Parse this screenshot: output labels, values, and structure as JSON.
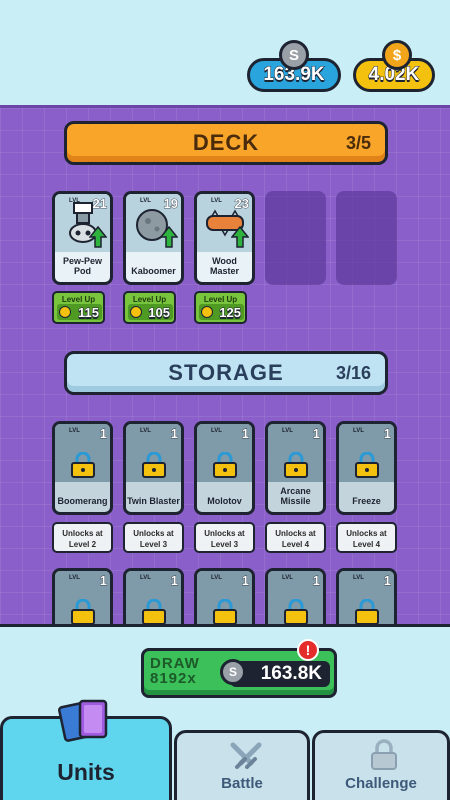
{
  "currency": {
    "silver_amount": "163.9K",
    "silver_symbol": "S",
    "gold_amount": "4.02K",
    "gold_symbol": "$"
  },
  "deck": {
    "title": "DECK",
    "count": "3/5",
    "cards": [
      {
        "name": "Pew-Pew Pod",
        "level": "21",
        "level_label": "LVL",
        "levelup_label": "Level Up",
        "cost": "115",
        "icon": "pod-turret-icon"
      },
      {
        "name": "Kaboomer",
        "level": "19",
        "level_label": "LVL",
        "levelup_label": "Level Up",
        "cost": "105",
        "icon": "bomb-icon"
      },
      {
        "name": "Wood Master",
        "level": "23",
        "level_label": "LVL",
        "levelup_label": "Level Up",
        "cost": "125",
        "icon": "log-icon"
      }
    ]
  },
  "storage": {
    "title": "STORAGE",
    "count": "3/16",
    "cards": [
      {
        "name": "Boomerang",
        "level": "1",
        "level_label": "LVL",
        "unlock": "Unlocks at Level 2"
      },
      {
        "name": "Twin Blaster",
        "level": "1",
        "level_label": "LVL",
        "unlock": "Unlocks at Level 3"
      },
      {
        "name": "Molotov",
        "level": "1",
        "level_label": "LVL",
        "unlock": "Unlocks at Level 3"
      },
      {
        "name": "Arcane Missile",
        "level": "1",
        "level_label": "LVL",
        "unlock": "Unlocks at Level 4"
      },
      {
        "name": "Freeze",
        "level": "1",
        "level_label": "LVL",
        "unlock": "Unlocks at Level 4"
      }
    ],
    "row2_levels": [
      "1",
      "1",
      "1",
      "1",
      "1"
    ],
    "row2_level_label": "LVL"
  },
  "draw": {
    "label": "DRAW",
    "count": "8192",
    "multiplier": "x",
    "cost": "163.8K",
    "coin_symbol": "S",
    "alert": "!"
  },
  "tabs": {
    "units": "Units",
    "battle": "Battle",
    "challenge": "Challenge"
  },
  "colors": {
    "background": "#c9eef5",
    "board": "#8a5fc9",
    "deck_banner": "#f8a52a",
    "storage_banner": "#bfe3f2",
    "levelup": "#78c43c",
    "draw_button": "#3bc05a",
    "units_tab_active": "#5fd6ee"
  }
}
